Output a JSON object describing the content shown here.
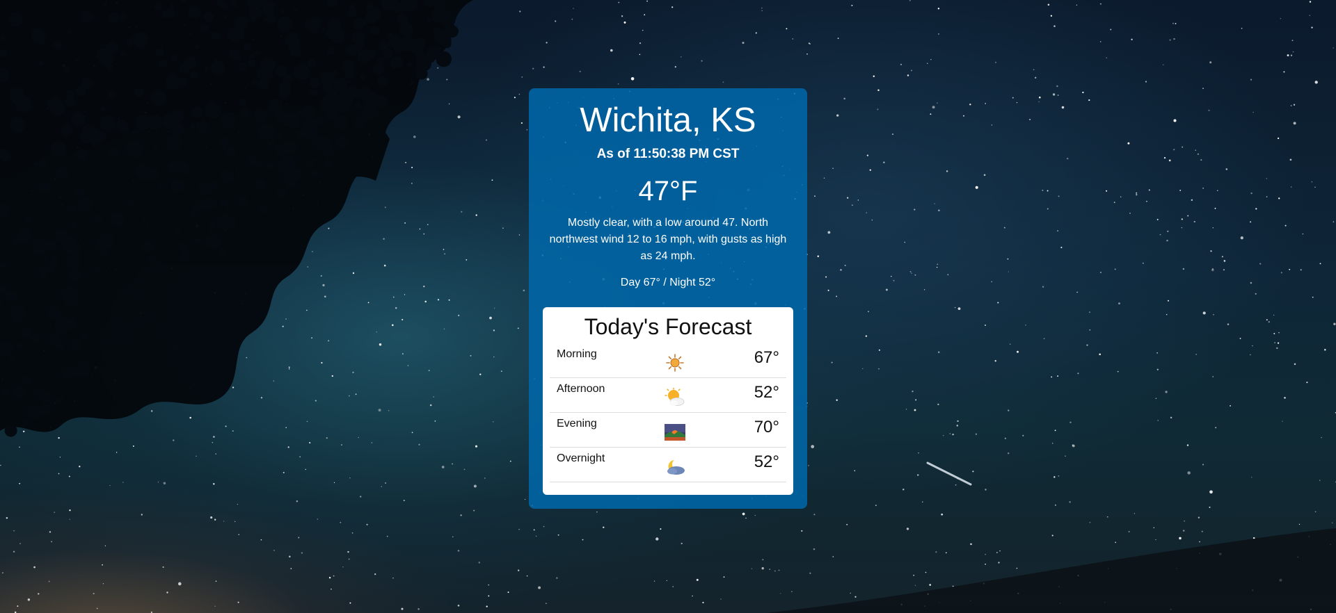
{
  "location": {
    "city": "Wichita, KS",
    "as_of": "As of 11:50:38 PM CST"
  },
  "current": {
    "temperature": "47°F",
    "description": "Mostly clear, with a low around 47. North northwest wind 12 to 16 mph, with gusts as high as 24 mph.",
    "day_night": "Day 67° / Night 52°"
  },
  "forecast": {
    "title": "Today's Forecast",
    "periods": [
      {
        "label": "Morning",
        "icon": "sun-icon",
        "temp": "67°"
      },
      {
        "label": "Afternoon",
        "icon": "sun-behind-cloud-icon",
        "temp": "52°"
      },
      {
        "label": "Evening",
        "icon": "sunset-icon",
        "temp": "70°"
      },
      {
        "label": "Overnight",
        "icon": "moon-cloud-icon",
        "temp": "52°"
      }
    ]
  },
  "colors": {
    "card": "#0068aa",
    "panel": "#ffffff",
    "text_light": "#ffffff",
    "text_dark": "#111111"
  }
}
